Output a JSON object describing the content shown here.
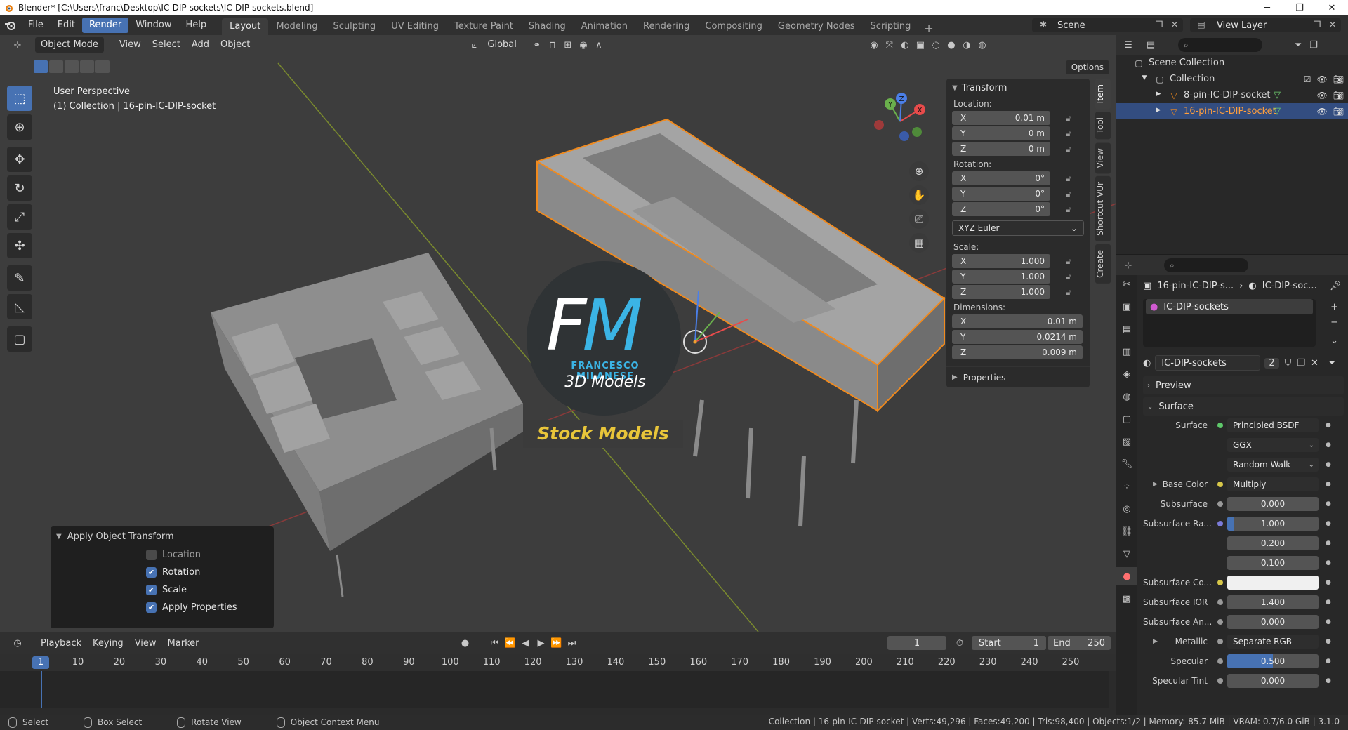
{
  "titlebar": {
    "title": "Blender* [C:\\Users\\franc\\Desktop\\IC-DIP-sockets\\IC-DIP-sockets.blend]",
    "minimize": "─",
    "maximize": "❐",
    "close": "✕"
  },
  "menubar": {
    "items": [
      "File",
      "Edit",
      "Render",
      "Window",
      "Help"
    ],
    "active_item": "Render",
    "workspaces": [
      "Layout",
      "Modeling",
      "Sculpting",
      "UV Editing",
      "Texture Paint",
      "Shading",
      "Animation",
      "Rendering",
      "Compositing",
      "Geometry Nodes",
      "Scripting"
    ],
    "active_workspace": "Layout",
    "add_tab": "+",
    "scene": "Scene",
    "view_layer": "View Layer"
  },
  "viewport": {
    "mode": "Object Mode",
    "menus": [
      "View",
      "Select",
      "Add",
      "Object"
    ],
    "orientation": "Global",
    "options": "Options",
    "info_line1": "User Perspective",
    "info_line2": "(1) Collection | 16-pin-IC-DIP-socket",
    "gizmo_axes": [
      "X",
      "Y",
      "Z"
    ]
  },
  "overlay_logo": {
    "letters_f": "F",
    "letters_m": "M",
    "line1": "FRANCESCO MILANESE",
    "line2": "3D Models",
    "banner": "Stock Models",
    "accent": "#3bb4e5",
    "banner_color": "#e8c53a"
  },
  "npanel": {
    "transform_title": "Transform",
    "location_label": "Location:",
    "location": [
      {
        "axis": "X",
        "value": "0.01 m"
      },
      {
        "axis": "Y",
        "value": "0 m"
      },
      {
        "axis": "Z",
        "value": "0 m"
      }
    ],
    "rotation_label": "Rotation:",
    "rotation": [
      {
        "axis": "X",
        "value": "0°"
      },
      {
        "axis": "Y",
        "value": "0°"
      },
      {
        "axis": "Z",
        "value": "0°"
      }
    ],
    "rotation_mode": "XYZ Euler",
    "scale_label": "Scale:",
    "scale": [
      {
        "axis": "X",
        "value": "1.000"
      },
      {
        "axis": "Y",
        "value": "1.000"
      },
      {
        "axis": "Z",
        "value": "1.000"
      }
    ],
    "dimensions_label": "Dimensions:",
    "dimensions": [
      {
        "axis": "X",
        "value": "0.01 m"
      },
      {
        "axis": "Y",
        "value": "0.0214 m"
      },
      {
        "axis": "Z",
        "value": "0.009 m"
      }
    ],
    "properties_title": "Properties",
    "tabs": [
      "Item",
      "Tool",
      "View",
      "Shortcut VUr",
      "Create"
    ]
  },
  "apply_panel": {
    "title": "Apply Object Transform",
    "options": [
      {
        "label": "Location",
        "checked": false
      },
      {
        "label": "Rotation",
        "checked": true
      },
      {
        "label": "Scale",
        "checked": true
      },
      {
        "label": "Apply Properties",
        "checked": true
      }
    ]
  },
  "timeline": {
    "menus": [
      "Playback",
      "Keying",
      "View",
      "Marker"
    ],
    "current_frame": "1",
    "start_label": "Start",
    "start": "1",
    "end_label": "End",
    "end": "250",
    "ticks": [
      "1",
      "10",
      "20",
      "30",
      "40",
      "50",
      "60",
      "70",
      "80",
      "90",
      "100",
      "110",
      "120",
      "130",
      "140",
      "150",
      "160",
      "170",
      "180",
      "190",
      "200",
      "210",
      "220",
      "230",
      "240",
      "250"
    ]
  },
  "statusbar": {
    "select": "Select",
    "box_select": "Box Select",
    "rotate_view": "Rotate View",
    "context_menu": "Object Context Menu",
    "stats": "Collection | 16-pin-IC-DIP-socket | Verts:49,296 | Faces:49,200 | Tris:98,400 | Objects:1/2 | Memory: 85.7 MiB | VRAM: 0.7/6.0 GiB | 3.1.0"
  },
  "outliner": {
    "root": "Scene Collection",
    "collection": "Collection",
    "objects": [
      {
        "name": "8-pin-IC-DIP-socket",
        "selected": false
      },
      {
        "name": "16-pin-IC-DIP-socket",
        "selected": true
      }
    ]
  },
  "properties": {
    "breadcrumb_object": "16-pin-IC-DIP-s...",
    "breadcrumb_material": "IC-DIP-soc...",
    "material_slot": "IC-DIP-sockets",
    "material_name": "IC-DIP-sockets",
    "material_users": "2",
    "preview_section": "Preview",
    "surface_section": "Surface",
    "rows": [
      {
        "label": "Surface",
        "value": "Principled BSDF",
        "dot": "#5ec86a",
        "style": "dark"
      },
      {
        "label": "",
        "value": "GGX",
        "dot": "",
        "style": "dark"
      },
      {
        "label": "",
        "value": "Random Walk",
        "dot": "",
        "style": "dark"
      },
      {
        "label": "Base Color",
        "value": "Multiply",
        "dot": "#d8c849",
        "style": "dark"
      },
      {
        "label": "Subsurface",
        "value": "0.000",
        "dot": "#9a9a9a",
        "style": "num"
      },
      {
        "label": "Subsurface Ra...",
        "value": "1.000",
        "dot": "#7b7bd8",
        "style": "num"
      },
      {
        "label": "",
        "value": "0.200",
        "dot": "",
        "style": "num"
      },
      {
        "label": "",
        "value": "0.100",
        "dot": "",
        "style": "num"
      },
      {
        "label": "Subsurface Co...",
        "value": "",
        "dot": "#d8c849",
        "style": "white"
      },
      {
        "label": "Subsurface IOR",
        "value": "1.400",
        "dot": "#9a9a9a",
        "style": "num"
      },
      {
        "label": "Subsurface An...",
        "value": "0.000",
        "dot": "#9a9a9a",
        "style": "num"
      },
      {
        "label": "Metallic",
        "value": "Separate RGB",
        "dot": "#9a9a9a",
        "style": "dark"
      },
      {
        "label": "Specular",
        "value": "0.500",
        "dot": "#9a9a9a",
        "style": "num"
      },
      {
        "label": "Specular Tint",
        "value": "0.000",
        "dot": "#9a9a9a",
        "style": "num"
      }
    ],
    "specular_fill": 0.5
  }
}
